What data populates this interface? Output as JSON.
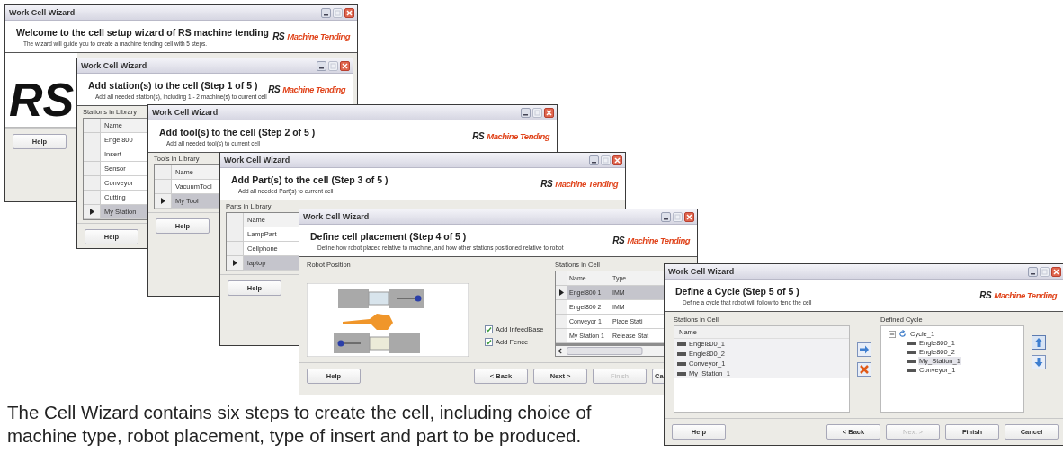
{
  "windows": [
    {
      "kind": "welcome",
      "title": "Work Cell Wizard",
      "heading": "Welcome to the cell setup wizard of RS machine tending",
      "subtitle": "The wizard will guide you to create a machine tending cell with 5 steps.",
      "logo": {
        "mark": "RS",
        "name": "Machine Tending"
      },
      "big_logo": "RS",
      "buttons": [
        {
          "label": "Help",
          "disabled": false
        }
      ]
    },
    {
      "kind": "library",
      "title": "Work Cell Wizard",
      "heading": "Add station(s) to the cell (Step 1 of 5 )",
      "subtitle": "Add all needed station(s), including 1 - 2 machine(s) to current cell",
      "logo": {
        "mark": "RS",
        "name": "Machine Tending"
      },
      "list_label": "Stations in Library",
      "column": "Name",
      "rows": [
        {
          "name": "Engel800",
          "selected": false
        },
        {
          "name": "Insert",
          "selected": false
        },
        {
          "name": "Sensor",
          "selected": false
        },
        {
          "name": "Conveyor",
          "selected": false
        },
        {
          "name": "Cutting",
          "selected": false
        },
        {
          "name": "My Station",
          "selected": true
        }
      ],
      "buttons": [
        {
          "label": "Help",
          "disabled": false
        }
      ]
    },
    {
      "kind": "library",
      "title": "Work Cell Wizard",
      "heading": "Add tool(s) to the cell (Step 2 of 5 )",
      "subtitle": "Add all needed tool(s) to current cell",
      "logo": {
        "mark": "RS",
        "name": "Machine Tending"
      },
      "list_label": "Tools in Library",
      "column": "Name",
      "rows": [
        {
          "name": "VacuumTool",
          "selected": false
        },
        {
          "name": "My Tool",
          "selected": true
        }
      ],
      "buttons": [
        {
          "label": "Help",
          "disabled": false
        }
      ]
    },
    {
      "kind": "library",
      "title": "Work Cell Wizard",
      "heading": "Add Part(s) to the cell (Step 3 of 5 )",
      "subtitle": "Add all needed Part(s) to current cell",
      "logo": {
        "mark": "RS",
        "name": "Machine Tending"
      },
      "list_label": "Parts in Library",
      "column": "Name",
      "rows": [
        {
          "name": "LampPart",
          "selected": false
        },
        {
          "name": "Cellphone",
          "selected": false
        },
        {
          "name": "laptop",
          "selected": true
        }
      ],
      "buttons": [
        {
          "label": "Help",
          "disabled": false
        }
      ]
    },
    {
      "kind": "placement",
      "title": "Work Cell Wizard",
      "heading": "Define cell placement (Step 4 of 5 )",
      "subtitle": "Define how robot placed relative to machine, and how other stations positioned relative to robot",
      "logo": {
        "mark": "RS",
        "name": "Machine Tending"
      },
      "diagram_label": "Robot Position",
      "options": [
        {
          "label": "Add InfeedBase",
          "checked": true
        },
        {
          "label": "Add Fence",
          "checked": true
        }
      ],
      "table_label": "Stations in Cell",
      "columns": [
        "Name",
        "Type"
      ],
      "rows": [
        {
          "cells": [
            "Engel800 1",
            "IMM"
          ],
          "selected": true
        },
        {
          "cells": [
            "Engel800 2",
            "IMM"
          ],
          "selected": false
        },
        {
          "cells": [
            "Conveyor 1",
            "Place Stati"
          ],
          "selected": false
        },
        {
          "cells": [
            "My Station 1",
            "Release Stat"
          ],
          "selected": false
        }
      ],
      "buttons": [
        {
          "label": "Help",
          "disabled": false
        },
        {
          "label": "< Back",
          "disabled": false
        },
        {
          "label": "Next >",
          "disabled": false
        },
        {
          "label": "Finish",
          "disabled": true
        },
        {
          "label": "Ca",
          "disabled": false
        }
      ]
    },
    {
      "kind": "cycle",
      "title": "Work Cell Wizard",
      "heading": "Define a Cycle (Step 5 of 5 )",
      "subtitle": "Define a cycle that robot will follow to tend the cell",
      "logo": {
        "mark": "RS",
        "name": "Machine Tending"
      },
      "list_label": "Stations in Cell",
      "column": "Name",
      "stations": [
        "Engel800_1",
        "Engle800_2",
        "Conveyor_1",
        "My_Station_1"
      ],
      "tree_label": "Defined Cycle",
      "tree": {
        "label": "Cycle_1",
        "expanded": true,
        "children": [
          {
            "label": "Engle800_1",
            "selected": false
          },
          {
            "label": "Engle800_2",
            "selected": false
          },
          {
            "label": "My_Station_1",
            "selected": true
          },
          {
            "label": "Conveyor_1",
            "selected": false
          }
        ]
      },
      "buttons": [
        {
          "label": "Help",
          "disabled": false
        },
        {
          "label": "< Back",
          "disabled": false
        },
        {
          "label": "Next >",
          "disabled": true
        },
        {
          "label": "Finish",
          "disabled": false
        },
        {
          "label": "Cancel",
          "disabled": false
        }
      ]
    }
  ],
  "caption": "The Cell Wizard contains six steps to create the cell, including choice of machine type, robot placement, type of insert and part to be produced."
}
